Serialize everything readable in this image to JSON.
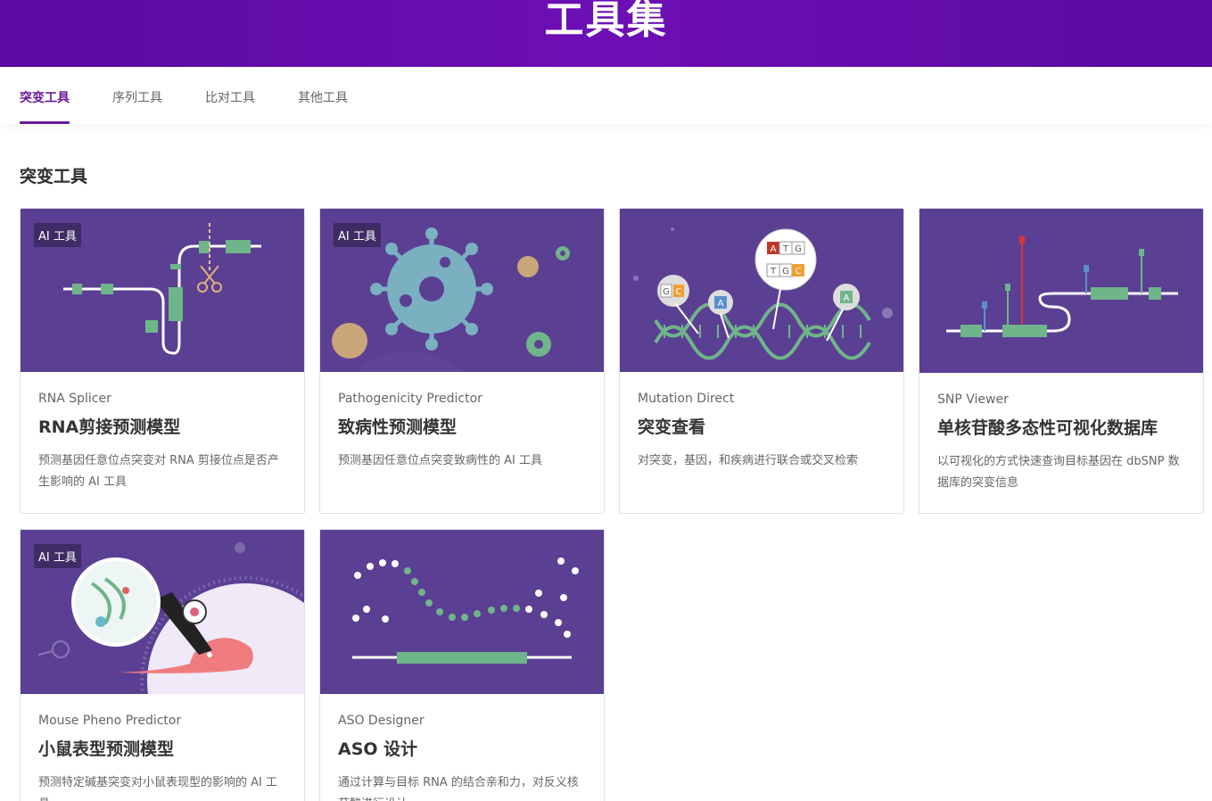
{
  "header": {
    "title": "工具集"
  },
  "tabs": [
    {
      "label": "突变工具"
    },
    {
      "label": "序列工具"
    },
    {
      "label": "比对工具"
    },
    {
      "label": "其他工具"
    }
  ],
  "section": {
    "title": "突变工具"
  },
  "cards": [
    {
      "badge": "AI 工具",
      "subtitle": "RNA Splicer",
      "title": "RNA剪接预测模型",
      "description": "预测基因任意位点突变对 RNA 剪接位点是否产生影响的 AI 工具"
    },
    {
      "badge": "AI 工具",
      "subtitle": "Pathogenicity Predictor",
      "title": "致病性预测模型",
      "description": "预测基因任意位点突变致病性的 AI 工具"
    },
    {
      "subtitle": "Mutation Direct",
      "title": "突变查看",
      "description": "对突变，基因，和疾病进行联合或交叉检索"
    },
    {
      "subtitle": "SNP Viewer",
      "title": "单核苷酸多态性可视化数据库",
      "description": "以可视化的方式快速查询目标基因在 dbSNP 数据库的突变信息"
    },
    {
      "badge": "AI 工具",
      "subtitle": "Mouse Pheno Predictor",
      "title": "小鼠表型预测模型",
      "description": "预测特定碱基突变对小鼠表现型的影响的 AI 工具"
    },
    {
      "subtitle": "ASO Designer",
      "title": "ASO 设计",
      "description": "通过计算与目标 RNA 的结合亲和力，对反义核苷酸进行设计"
    }
  ],
  "illustration_letters": {
    "mutation_atg": [
      "A",
      "T",
      "G"
    ],
    "mutation_tgc": [
      "T",
      "G",
      "C"
    ],
    "mutation_gc": [
      "G",
      "C"
    ],
    "mutation_a": "A"
  },
  "colors": {
    "hero": "#6d0fb5",
    "accent": "#6a1b9a",
    "card_image_bg": "#5b3f93",
    "green": "#6fb58a"
  }
}
